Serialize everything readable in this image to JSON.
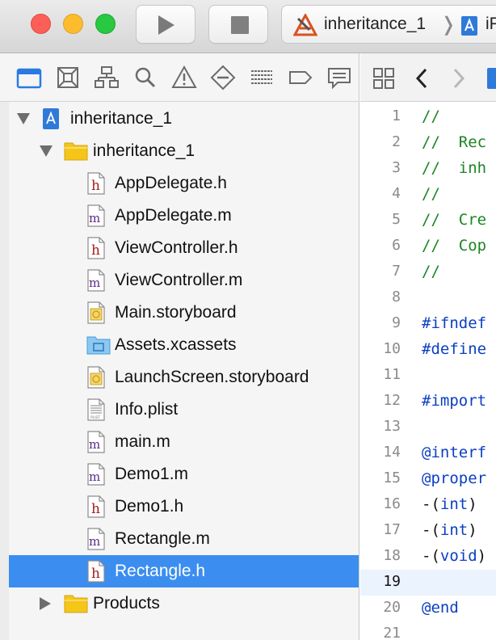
{
  "window": {
    "scheme": {
      "target_label": "inheritance_1",
      "separator": "❭",
      "device_label": "iP"
    }
  },
  "navigator": {
    "tabs": [
      {
        "name": "project-navigator",
        "icon": "folder-icon"
      },
      {
        "name": "source-control-navigator",
        "icon": "source-control-icon"
      },
      {
        "name": "symbol-navigator",
        "icon": "hierarchy-icon"
      },
      {
        "name": "find-navigator",
        "icon": "search-icon"
      },
      {
        "name": "issue-navigator",
        "icon": "warning-icon"
      },
      {
        "name": "test-navigator",
        "icon": "diamond-icon"
      },
      {
        "name": "debug-navigator",
        "icon": "list-icon"
      },
      {
        "name": "breakpoint-navigator",
        "icon": "breakpoint-icon"
      },
      {
        "name": "report-navigator",
        "icon": "speech-bubble-icon"
      }
    ],
    "project": {
      "name": "inheritance_1",
      "expanded": true
    },
    "group": {
      "name": "inheritance_1",
      "expanded": true
    },
    "files": [
      {
        "name": "AppDelegate.h",
        "type": "h"
      },
      {
        "name": "AppDelegate.m",
        "type": "m"
      },
      {
        "name": "ViewController.h",
        "type": "h"
      },
      {
        "name": "ViewController.m",
        "type": "m"
      },
      {
        "name": "Main.storyboard",
        "type": "storyboard"
      },
      {
        "name": "Assets.xcassets",
        "type": "xcassets"
      },
      {
        "name": "LaunchScreen.storyboard",
        "type": "storyboard"
      },
      {
        "name": "Info.plist",
        "type": "plist"
      },
      {
        "name": "main.m",
        "type": "m"
      },
      {
        "name": "Demo1.m",
        "type": "m"
      },
      {
        "name": "Demo1.h",
        "type": "h"
      },
      {
        "name": "Rectangle.m",
        "type": "m"
      },
      {
        "name": "Rectangle.h",
        "type": "h",
        "selected": true
      }
    ],
    "products": {
      "name": "Products",
      "expanded": false
    }
  },
  "editor": {
    "current_line": 19,
    "lines": [
      {
        "n": "1",
        "parts": [
          [
            "comment",
            "//"
          ]
        ]
      },
      {
        "n": "2",
        "parts": [
          [
            "comment",
            "//  Rec"
          ]
        ]
      },
      {
        "n": "3",
        "parts": [
          [
            "comment",
            "//  inh"
          ]
        ]
      },
      {
        "n": "4",
        "parts": [
          [
            "comment",
            "//"
          ]
        ]
      },
      {
        "n": "5",
        "parts": [
          [
            "comment",
            "//  Cre"
          ]
        ]
      },
      {
        "n": "6",
        "parts": [
          [
            "comment",
            "//  Cop"
          ]
        ]
      },
      {
        "n": "7",
        "parts": [
          [
            "comment",
            "//"
          ]
        ]
      },
      {
        "n": "8",
        "parts": []
      },
      {
        "n": "9",
        "parts": [
          [
            "blue",
            "#ifndef"
          ]
        ]
      },
      {
        "n": "10",
        "parts": [
          [
            "blue",
            "#define"
          ]
        ]
      },
      {
        "n": "11",
        "parts": []
      },
      {
        "n": "12",
        "parts": [
          [
            "blue",
            "#import"
          ]
        ]
      },
      {
        "n": "13",
        "parts": []
      },
      {
        "n": "14",
        "parts": [
          [
            "blue",
            "@interf"
          ]
        ]
      },
      {
        "n": "15",
        "parts": [
          [
            "blue",
            "@proper"
          ]
        ]
      },
      {
        "n": "16",
        "parts": [
          [
            "plain",
            "-("
          ],
          [
            "blue",
            "int"
          ],
          [
            "plain",
            ")"
          ]
        ]
      },
      {
        "n": "17",
        "parts": [
          [
            "plain",
            "-("
          ],
          [
            "blue",
            "int"
          ],
          [
            "plain",
            ")"
          ]
        ]
      },
      {
        "n": "18",
        "parts": [
          [
            "plain",
            "-("
          ],
          [
            "blue",
            "void"
          ],
          [
            "plain",
            ")"
          ]
        ]
      },
      {
        "n": "19",
        "parts": []
      },
      {
        "n": "20",
        "parts": [
          [
            "blue",
            "@end"
          ]
        ]
      },
      {
        "n": "21",
        "parts": []
      }
    ]
  },
  "colors": {
    "selection": "#3b8eef",
    "comment": "#1d8523",
    "keyword": "#0b3fc2",
    "header_icon": "#a51c1c",
    "impl_icon": "#5b2a86",
    "folder": "#f5c518"
  }
}
